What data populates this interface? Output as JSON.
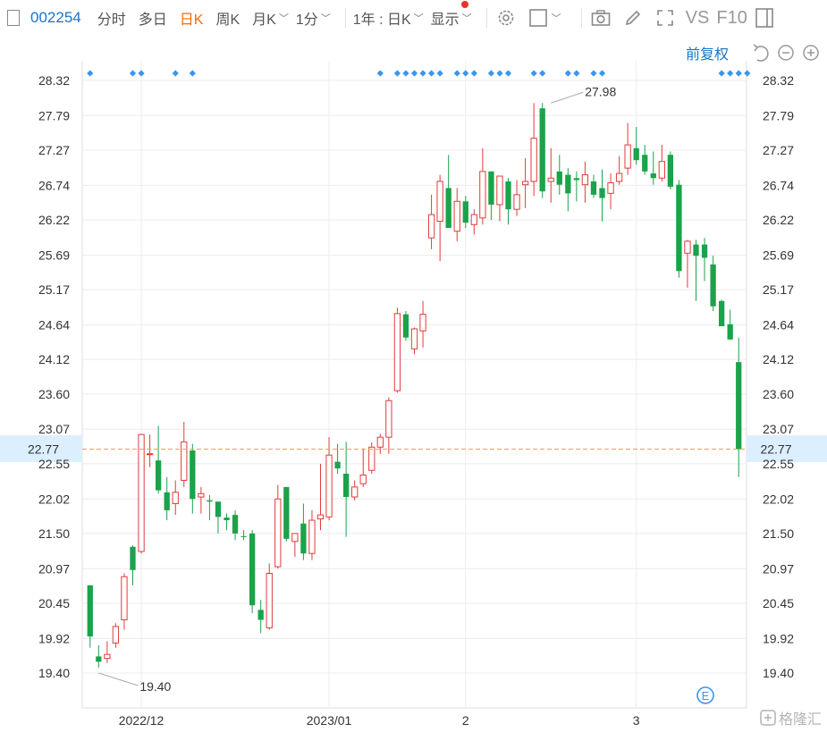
{
  "toolbar": {
    "stock_code": "002254",
    "tabs": [
      "分时",
      "多日",
      "日K",
      "周K"
    ],
    "active_tab": "日K",
    "month_k": "月K",
    "minute": "1分",
    "range": "1年 : 日K",
    "display": "显示",
    "vs": "VS",
    "f10": "F10"
  },
  "adjust_label": "前复权",
  "watermark": "格隆汇",
  "colors": {
    "up": "#e23b3b",
    "down": "#1aa34a",
    "dot": "#3c94ee",
    "grid": "#ececec",
    "ref_line": "#f0a050",
    "highlight": "#dcefff",
    "link": "#1a73c8"
  },
  "chart_data": {
    "type": "candlestick",
    "y_ticks": [
      "28.32",
      "27.79",
      "27.27",
      "26.74",
      "26.22",
      "25.69",
      "25.17",
      "24.64",
      "24.12",
      "23.60",
      "23.07",
      "22.55",
      "22.02",
      "21.50",
      "20.97",
      "20.45",
      "19.92",
      "19.40"
    ],
    "ylim": [
      19.4,
      28.32
    ],
    "x_labels": [
      {
        "label": "2022/12",
        "index": 6
      },
      {
        "label": "2023/01",
        "index": 28
      },
      {
        "label": "2",
        "index": 44
      },
      {
        "label": "3",
        "index": 64
      }
    ],
    "last_price": "22.77",
    "max_label": "27.98",
    "max_index": 54,
    "min_label": "19.40",
    "min_index": 1,
    "marker_indices": [
      0,
      5,
      6,
      10,
      12,
      34,
      36,
      37,
      38,
      39,
      40,
      41,
      43,
      44,
      45,
      47,
      48,
      49,
      52,
      53,
      56,
      57,
      59,
      60,
      74,
      75,
      76,
      77
    ],
    "candles": [
      {
        "o": 20.72,
        "h": 20.72,
        "l": 19.78,
        "c": 19.95
      },
      {
        "o": 19.65,
        "h": 19.82,
        "l": 19.48,
        "c": 19.57
      },
      {
        "o": 19.62,
        "h": 19.88,
        "l": 19.55,
        "c": 19.68
      },
      {
        "o": 19.85,
        "h": 20.15,
        "l": 19.78,
        "c": 20.1
      },
      {
        "o": 20.2,
        "h": 20.9,
        "l": 20.05,
        "c": 20.85
      },
      {
        "o": 21.3,
        "h": 21.32,
        "l": 20.72,
        "c": 20.95
      },
      {
        "o": 21.23,
        "h": 23.0,
        "l": 21.2,
        "c": 22.99
      },
      {
        "o": 22.7,
        "h": 22.99,
        "l": 22.5,
        "c": 22.7
      },
      {
        "o": 22.6,
        "h": 23.12,
        "l": 22.1,
        "c": 22.15
      },
      {
        "o": 22.12,
        "h": 22.35,
        "l": 21.7,
        "c": 21.85
      },
      {
        "o": 21.95,
        "h": 22.3,
        "l": 21.78,
        "c": 22.12
      },
      {
        "o": 22.3,
        "h": 23.18,
        "l": 22.2,
        "c": 22.88
      },
      {
        "o": 22.75,
        "h": 22.85,
        "l": 21.8,
        "c": 22.02
      },
      {
        "o": 22.05,
        "h": 22.2,
        "l": 21.8,
        "c": 22.1
      },
      {
        "o": 22.0,
        "h": 22.08,
        "l": 21.7,
        "c": 21.98
      },
      {
        "o": 21.98,
        "h": 21.98,
        "l": 21.5,
        "c": 21.75
      },
      {
        "o": 21.74,
        "h": 21.8,
        "l": 21.55,
        "c": 21.7
      },
      {
        "o": 21.78,
        "h": 21.85,
        "l": 21.4,
        "c": 21.5
      },
      {
        "o": 21.46,
        "h": 21.55,
        "l": 21.4,
        "c": 21.45
      },
      {
        "o": 21.5,
        "h": 21.55,
        "l": 20.3,
        "c": 20.42
      },
      {
        "o": 20.35,
        "h": 20.5,
        "l": 20.0,
        "c": 20.2
      },
      {
        "o": 20.08,
        "h": 21.05,
        "l": 20.05,
        "c": 20.9
      },
      {
        "o": 21.0,
        "h": 22.23,
        "l": 20.97,
        "c": 22.02
      },
      {
        "o": 22.2,
        "h": 22.2,
        "l": 21.38,
        "c": 21.42
      },
      {
        "o": 21.38,
        "h": 21.5,
        "l": 21.15,
        "c": 21.5
      },
      {
        "o": 21.65,
        "h": 21.95,
        "l": 21.1,
        "c": 21.2
      },
      {
        "o": 21.2,
        "h": 21.85,
        "l": 21.1,
        "c": 21.7
      },
      {
        "o": 21.72,
        "h": 22.55,
        "l": 21.55,
        "c": 21.78
      },
      {
        "o": 21.75,
        "h": 22.95,
        "l": 21.7,
        "c": 22.68
      },
      {
        "o": 22.58,
        "h": 22.85,
        "l": 22.4,
        "c": 22.48
      },
      {
        "o": 22.4,
        "h": 22.88,
        "l": 21.45,
        "c": 22.05
      },
      {
        "o": 22.05,
        "h": 22.3,
        "l": 22.0,
        "c": 22.2
      },
      {
        "o": 22.25,
        "h": 22.78,
        "l": 22.2,
        "c": 22.38
      },
      {
        "o": 22.45,
        "h": 22.87,
        "l": 22.4,
        "c": 22.8
      },
      {
        "o": 22.8,
        "h": 23.0,
        "l": 22.7,
        "c": 22.95
      },
      {
        "o": 22.95,
        "h": 23.55,
        "l": 22.7,
        "c": 23.5
      },
      {
        "o": 23.65,
        "h": 24.9,
        "l": 23.62,
        "c": 24.81
      },
      {
        "o": 24.8,
        "h": 24.85,
        "l": 24.4,
        "c": 24.45
      },
      {
        "o": 24.28,
        "h": 24.6,
        "l": 24.2,
        "c": 24.58
      },
      {
        "o": 24.55,
        "h": 25.0,
        "l": 24.3,
        "c": 24.8
      },
      {
        "o": 25.95,
        "h": 26.6,
        "l": 25.78,
        "c": 26.3
      },
      {
        "o": 26.2,
        "h": 26.9,
        "l": 25.6,
        "c": 26.8
      },
      {
        "o": 26.7,
        "h": 27.2,
        "l": 26.1,
        "c": 26.1
      },
      {
        "o": 26.05,
        "h": 26.7,
        "l": 25.9,
        "c": 26.5
      },
      {
        "o": 26.5,
        "h": 26.58,
        "l": 26.1,
        "c": 26.18
      },
      {
        "o": 26.15,
        "h": 26.38,
        "l": 26.0,
        "c": 26.3
      },
      {
        "o": 26.25,
        "h": 27.3,
        "l": 26.15,
        "c": 26.95
      },
      {
        "o": 26.95,
        "h": 26.95,
        "l": 26.22,
        "c": 26.45
      },
      {
        "o": 26.45,
        "h": 26.85,
        "l": 26.2,
        "c": 26.88
      },
      {
        "o": 26.8,
        "h": 26.85,
        "l": 26.15,
        "c": 26.38
      },
      {
        "o": 26.38,
        "h": 26.82,
        "l": 26.28,
        "c": 26.6
      },
      {
        "o": 26.75,
        "h": 27.15,
        "l": 26.4,
        "c": 26.8
      },
      {
        "o": 26.8,
        "h": 27.98,
        "l": 26.58,
        "c": 27.45
      },
      {
        "o": 27.9,
        "h": 27.98,
        "l": 26.55,
        "c": 26.65
      },
      {
        "o": 26.8,
        "h": 27.3,
        "l": 26.48,
        "c": 26.85
      },
      {
        "o": 26.95,
        "h": 27.2,
        "l": 26.6,
        "c": 26.75
      },
      {
        "o": 26.9,
        "h": 27.0,
        "l": 26.35,
        "c": 26.62
      },
      {
        "o": 26.85,
        "h": 26.95,
        "l": 26.5,
        "c": 26.82
      },
      {
        "o": 26.75,
        "h": 27.1,
        "l": 26.48,
        "c": 26.9
      },
      {
        "o": 26.8,
        "h": 26.9,
        "l": 26.55,
        "c": 26.6
      },
      {
        "o": 26.7,
        "h": 26.98,
        "l": 26.2,
        "c": 26.55
      },
      {
        "o": 26.62,
        "h": 26.92,
        "l": 26.38,
        "c": 26.78
      },
      {
        "o": 26.8,
        "h": 27.18,
        "l": 26.75,
        "c": 26.92
      },
      {
        "o": 27.0,
        "h": 27.68,
        "l": 26.9,
        "c": 27.35
      },
      {
        "o": 27.3,
        "h": 27.62,
        "l": 27.05,
        "c": 27.12
      },
      {
        "o": 27.2,
        "h": 27.35,
        "l": 26.9,
        "c": 26.95
      },
      {
        "o": 26.92,
        "h": 27.25,
        "l": 26.75,
        "c": 26.85
      },
      {
        "o": 26.85,
        "h": 27.35,
        "l": 26.8,
        "c": 27.1
      },
      {
        "o": 27.2,
        "h": 27.25,
        "l": 26.68,
        "c": 26.72
      },
      {
        "o": 26.75,
        "h": 26.82,
        "l": 25.35,
        "c": 25.45
      },
      {
        "o": 25.72,
        "h": 25.92,
        "l": 25.2,
        "c": 25.9
      },
      {
        "o": 25.85,
        "h": 25.92,
        "l": 25.0,
        "c": 25.68
      },
      {
        "o": 25.85,
        "h": 25.95,
        "l": 25.3,
        "c": 25.65
      },
      {
        "o": 25.55,
        "h": 25.68,
        "l": 24.85,
        "c": 24.92
      },
      {
        "o": 25.0,
        "h": 25.02,
        "l": 24.62,
        "c": 24.62
      },
      {
        "o": 24.65,
        "h": 24.87,
        "l": 24.42,
        "c": 24.42
      },
      {
        "o": 24.08,
        "h": 24.45,
        "l": 22.35,
        "c": 22.77
      }
    ]
  }
}
